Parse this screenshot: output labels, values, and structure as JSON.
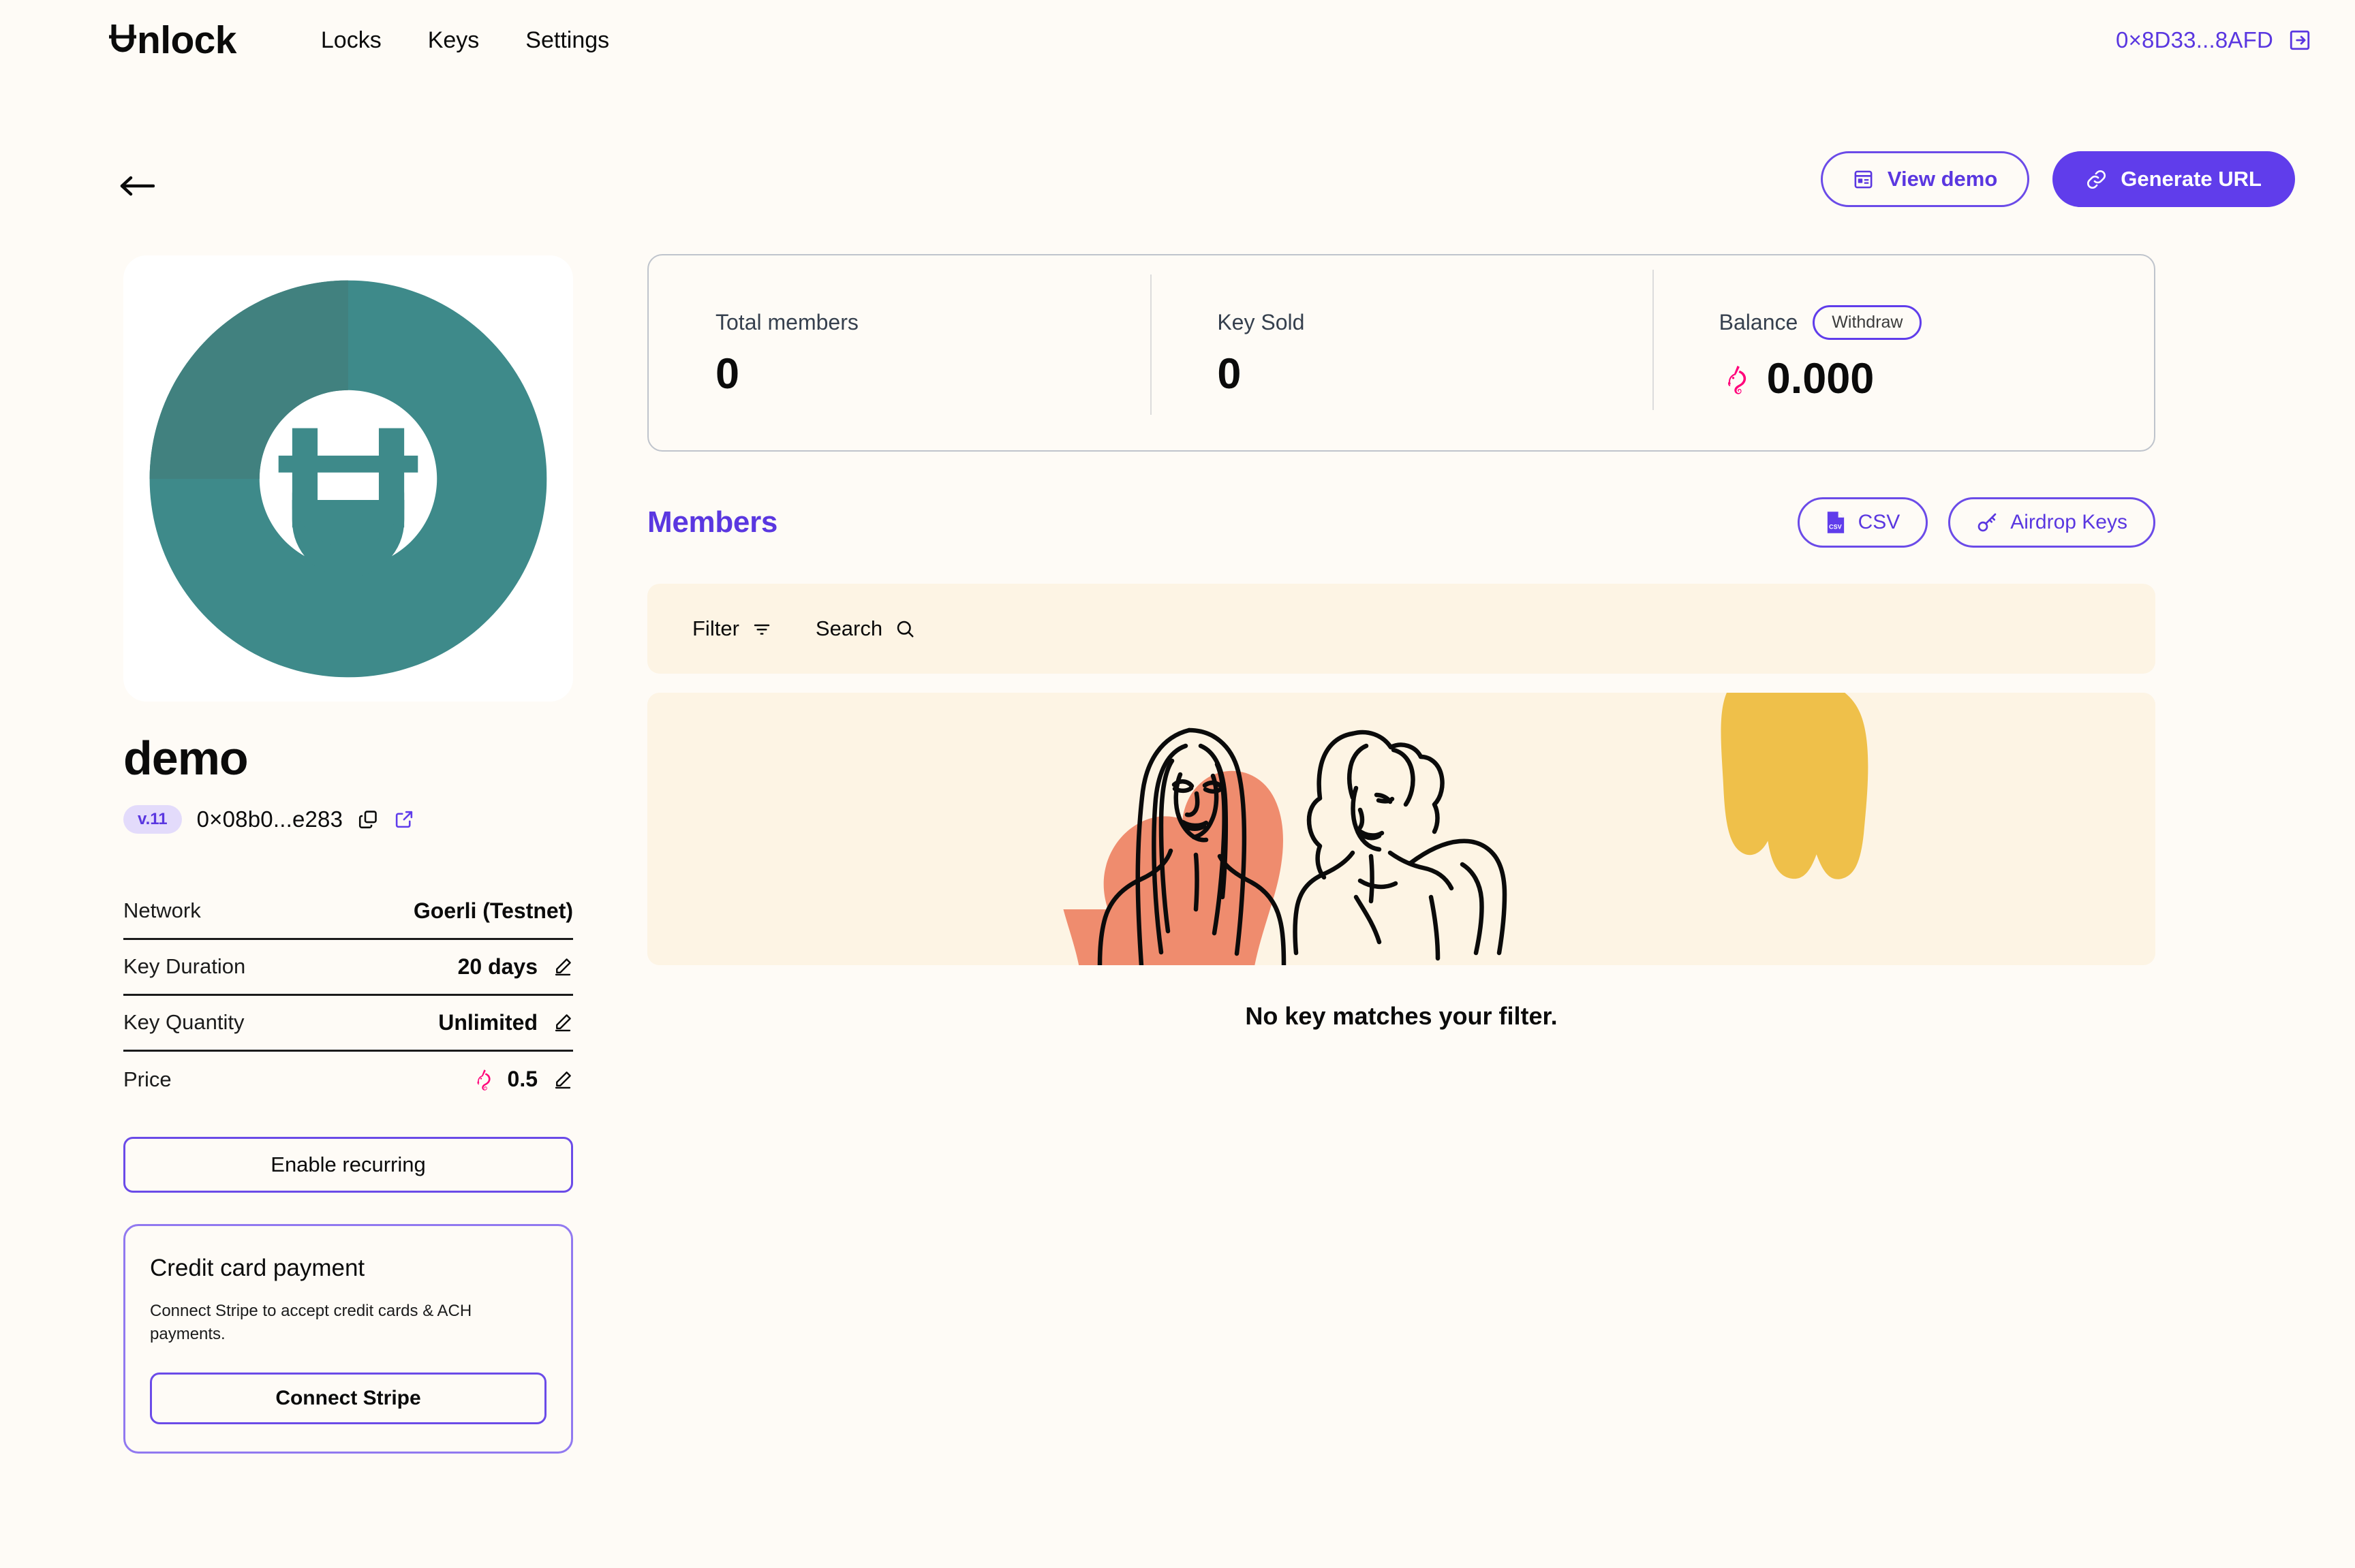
{
  "header": {
    "brand": "Unlock",
    "nav": [
      {
        "label": "Locks",
        "name": "nav-locks"
      },
      {
        "label": "Keys",
        "name": "nav-keys"
      },
      {
        "label": "Settings",
        "name": "nav-settings"
      }
    ],
    "wallet_address": "0×8D33...8AFD",
    "logout_icon": "logout-icon"
  },
  "top_actions": {
    "back_icon": "arrow-left-icon",
    "view_demo": "View demo",
    "view_demo_icon": "layout-preview-icon",
    "generate_url": "Generate URL",
    "generate_url_icon": "link-icon"
  },
  "lock": {
    "avatar_icon": "unlock-lock-avatar",
    "name": "demo",
    "version": "v.11",
    "address": "0×08b0...e283",
    "copy_icon": "copy-icon",
    "external_link_icon": "external-link-icon",
    "details": [
      {
        "label": "Network",
        "value": "Goerli (Testnet)",
        "editable": false,
        "currency": false
      },
      {
        "label": "Key Duration",
        "value": "20 days",
        "editable": true,
        "currency": false
      },
      {
        "label": "Key Quantity",
        "value": "Unlimited",
        "editable": true,
        "currency": false
      },
      {
        "label": "Price",
        "value": "0.5",
        "editable": true,
        "currency": true
      }
    ],
    "edit_icon": "pencil-edit-icon",
    "currency_icon": "unicorn-token-icon",
    "enable_recurring": "Enable recurring"
  },
  "stripe": {
    "title": "Credit card payment",
    "description": "Connect Stripe to accept credit cards & ACH payments.",
    "button": "Connect Stripe"
  },
  "stats": [
    {
      "label": "Total members",
      "value": "0",
      "badge": null,
      "currency": false
    },
    {
      "label": "Key Sold",
      "value": "0",
      "badge": null,
      "currency": false
    },
    {
      "label": "Balance",
      "value": "0.000",
      "badge": "Withdraw",
      "currency": true
    }
  ],
  "members": {
    "title": "Members",
    "csv_label": "CSV",
    "csv_icon": "csv-file-icon",
    "airdrop_label": "Airdrop Keys",
    "airdrop_icon": "key-icon",
    "filter_label": "Filter",
    "filter_icon": "filter-lines-icon",
    "search_label": "Search",
    "search_icon": "search-icon",
    "empty_text": "No key matches your filter.",
    "empty_illustration": "two-people-line-art-illustration"
  },
  "colors": {
    "page_bg": "#FEFBF6",
    "panel_bg": "#FDF4E4",
    "accent": "#603DEB",
    "accent_text": "#5A37E0",
    "accent_soft": "#E3DBFB",
    "text": "#0B0B0B",
    "muted": "#36404E",
    "border": "#BFC4CC",
    "token_pink": "#FF007A",
    "avatar_teal": "#3E8A8A",
    "illus_coral": "#EF8C6E",
    "illus_yellow": "#EFC04A"
  }
}
